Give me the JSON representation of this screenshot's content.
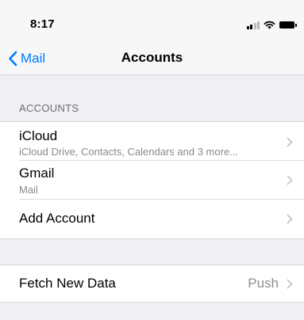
{
  "status_bar": {
    "time": "8:17",
    "icons": [
      "cellular-signal-icon",
      "wifi-icon",
      "battery-icon"
    ]
  },
  "nav": {
    "back_label": "Mail",
    "title": "Accounts"
  },
  "accounts_section": {
    "header": "ACCOUNTS",
    "items": [
      {
        "title": "iCloud",
        "subtitle": "iCloud Drive, Contacts, Calendars and 3 more..."
      },
      {
        "title": "Gmail",
        "subtitle": "Mail"
      },
      {
        "title": "Add Account"
      }
    ]
  },
  "fetch_section": {
    "title": "Fetch New Data",
    "value": "Push"
  },
  "colors": {
    "accent": "#007aff",
    "background": "#efeff4",
    "secondary_text": "#8a8a8e",
    "chevron": "#c4c4c7"
  }
}
